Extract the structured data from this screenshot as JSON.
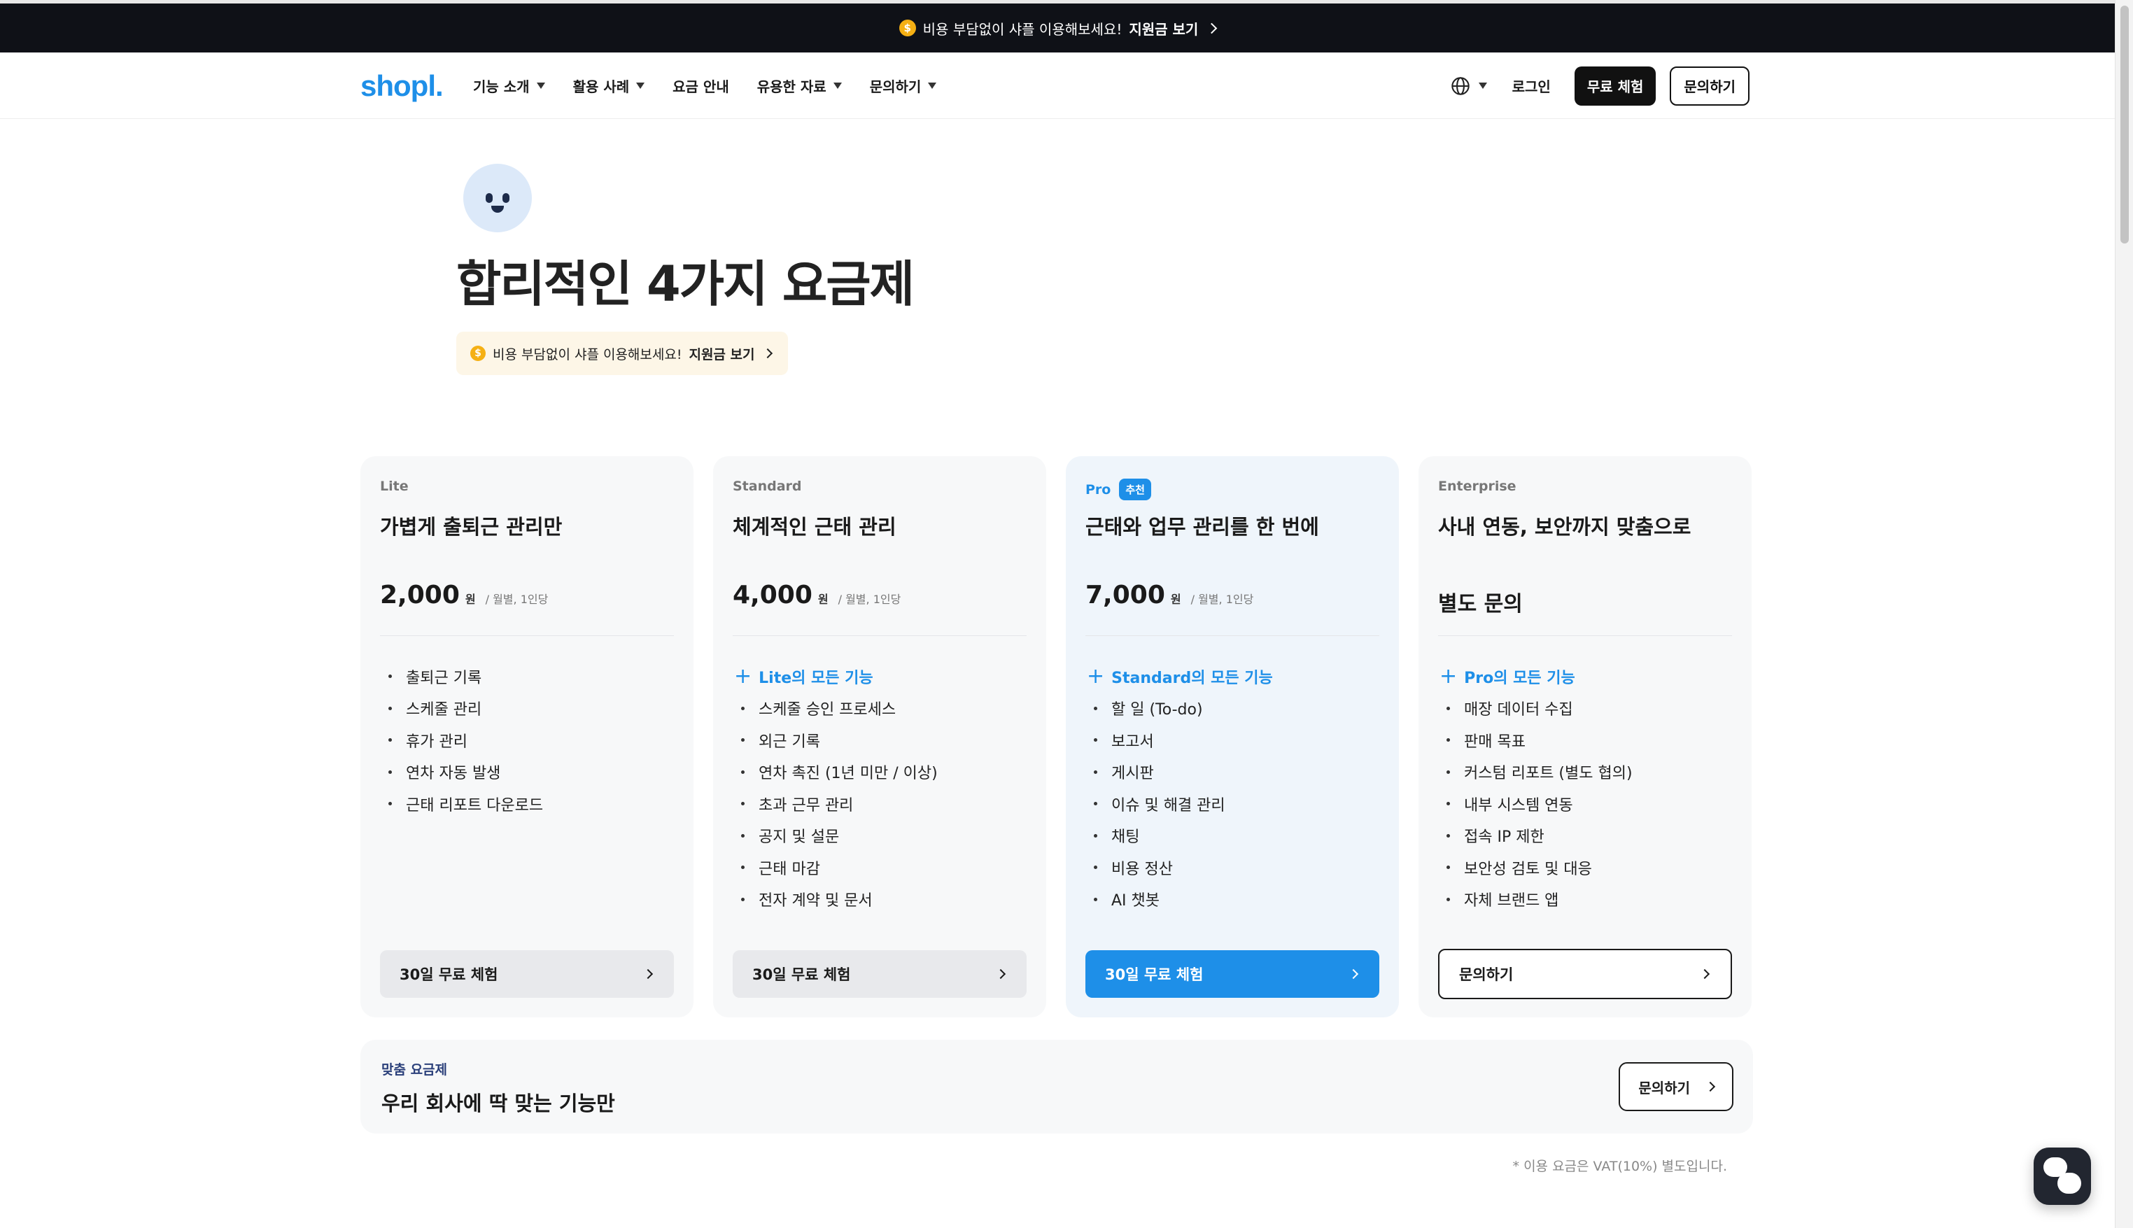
{
  "banner": {
    "coin": "$",
    "text": "비용 부담없이 샤플 이용해보세요!",
    "link": "지원금 보기"
  },
  "nav": {
    "logo": "shopl.",
    "menu": [
      {
        "label": "기능 소개",
        "has_dropdown": true
      },
      {
        "label": "활용 사례",
        "has_dropdown": true
      },
      {
        "label": "요금 안내",
        "has_dropdown": false
      },
      {
        "label": "유용한 자료",
        "has_dropdown": true
      },
      {
        "label": "문의하기",
        "has_dropdown": true
      }
    ],
    "login": "로그인",
    "free_trial": "무료 체험",
    "contact": "문의하기"
  },
  "hero": {
    "title": "합리적인 4가지 요금제",
    "pill_text": "비용 부담없이 샤플 이용해보세요!",
    "pill_link": "지원금 보기"
  },
  "plans": [
    {
      "tier": "Lite",
      "headline": "가볍게 출퇴근 관리만",
      "price": "2,000",
      "unit": "원",
      "per": "/ 월별, 1인당",
      "features": [
        "출퇴근 기록",
        "스케줄 관리",
        "휴가 관리",
        "연차 자동 발생",
        "근태 리포트 다운로드"
      ],
      "cta": "30일 무료 체험"
    },
    {
      "tier": "Standard",
      "headline": "체계적인 근태 관리",
      "price": "4,000",
      "unit": "원",
      "per": "/ 월별, 1인당",
      "includes": "Lite의 모든 기능",
      "features": [
        "스케줄 승인 프로세스",
        "외근 기록",
        "연차 촉진 (1년 미만 / 이상)",
        "초과 근무 관리",
        "공지 및 설문",
        "근태 마감",
        "전자 계약 및 문서"
      ],
      "cta": "30일 무료 체험"
    },
    {
      "tier": "Pro",
      "badge": "추천",
      "headline": "근태와 업무 관리를 한 번에",
      "price": "7,000",
      "unit": "원",
      "per": "/ 월별, 1인당",
      "includes": "Standard의 모든 기능",
      "features": [
        "할 일 (To-do)",
        "보고서",
        "게시판",
        "이슈 및 해결 관리",
        "채팅",
        "비용 정산",
        "AI 챗봇"
      ],
      "cta": "30일 무료 체험"
    },
    {
      "tier": "Enterprise",
      "headline": "사내 연동, 보안까지 맞춤으로",
      "price_text": "별도 문의",
      "includes": "Pro의 모든 기능",
      "features": [
        "매장 데이터 수집",
        "판매 목표",
        "커스텀 리포트 (별도 협의)",
        "내부 시스템 연동",
        "접속 IP 제한",
        "보안성 검토 및 대응",
        "자체 브랜드 앱"
      ],
      "cta": "문의하기"
    }
  ],
  "custom_plan": {
    "label": "맞춤 요금제",
    "title": "우리 회사에 딱 맞는 기능만",
    "button": "문의하기"
  },
  "vat_note": "* 이용 요금은 VAT(10%) 별도입니다.",
  "colors": {
    "brand": "#1e8fe8",
    "banner_bg": "#0f1117",
    "coin": "#f5b014"
  }
}
